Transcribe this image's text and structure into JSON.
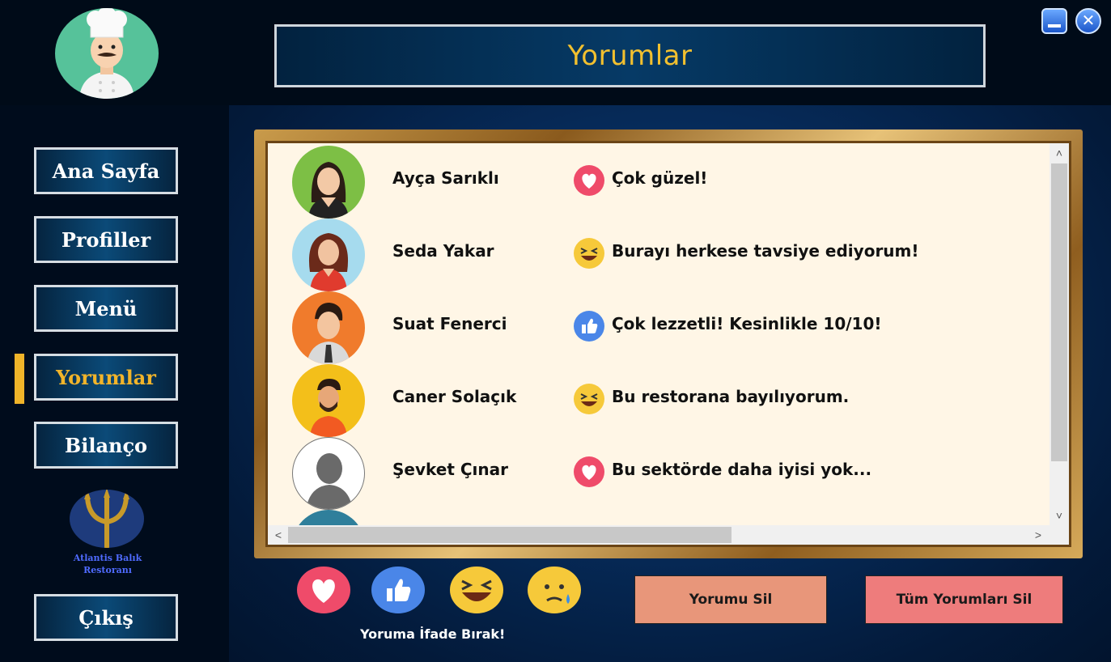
{
  "header": {
    "title": "Yorumlar"
  },
  "sidebar": {
    "items": [
      {
        "label": "Ana Sayfa"
      },
      {
        "label": "Profiller"
      },
      {
        "label": "Menü"
      },
      {
        "label": "Yorumlar"
      },
      {
        "label": "Bilanço"
      }
    ],
    "active_index": 3,
    "logo_text_1": "Atlantis Balık",
    "logo_text_2": "Restoranı",
    "exit_label": "Çıkış"
  },
  "comments": [
    {
      "name": "Ayça Sarıklı",
      "reaction": "heart-icon",
      "text": "Çok güzel!"
    },
    {
      "name": "Seda Yakar",
      "reaction": "laugh-icon",
      "text": "Burayı herkese tavsiye ediyorum!"
    },
    {
      "name": "Suat Fenerci",
      "reaction": "thumbs-up-icon",
      "text": "Çok lezzetli! Kesinlikle 10/10!"
    },
    {
      "name": "Caner Solaçık",
      "reaction": "laugh-icon",
      "text": "Bu restorana bayılıyorum."
    },
    {
      "name": "Şevket Çınar",
      "reaction": "heart-icon",
      "text": "Bu sektörde daha iyisi yok..."
    }
  ],
  "reactions": {
    "caption": "Yoruma İfade Bırak!"
  },
  "actions": {
    "delete_one": "Yorumu Sil",
    "delete_all": "Tüm Yorumları Sil"
  },
  "colors": {
    "accent": "#f2b42a",
    "delete_one_bg": "#e8967a",
    "delete_all_bg": "#ee7c7c"
  }
}
